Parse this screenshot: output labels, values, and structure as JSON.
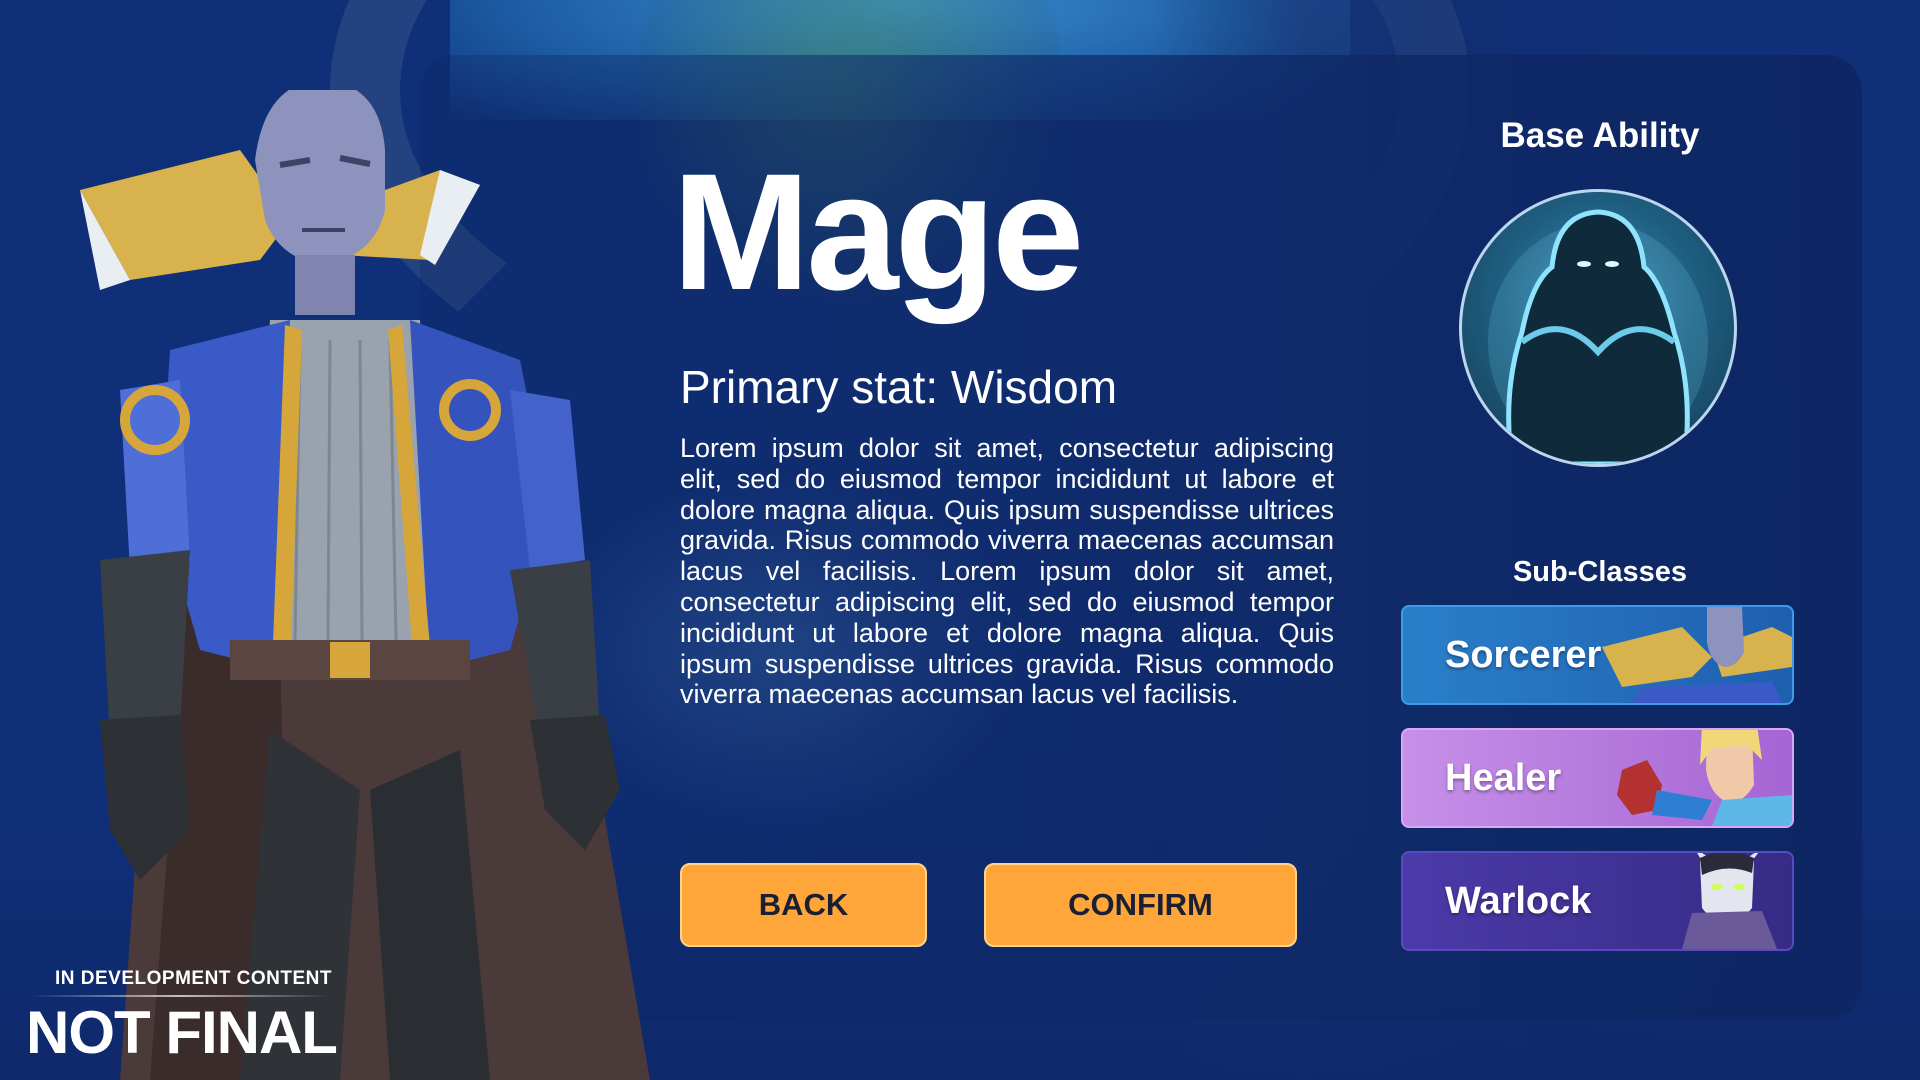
{
  "class_select": {
    "class_name": "Mage",
    "primary_stat": "Primary stat: Wisdom",
    "description": "Lorem ipsum dolor sit amet, consectetur adipiscing elit, sed do eiusmod tempor incididunt ut labore et dolore magna aliqua. Quis ipsum suspendisse ultrices gravida. Risus commodo viverra maecenas accumsan lacus vel facilisis. Lorem ipsum dolor sit amet, consectetur adipiscing elit, sed do eiusmod tempor incididunt ut labore et dolore magna aliqua. Quis ipsum suspendisse ultrices gravida. Risus commodo viverra maecenas accumsan lacus vel facilisis.",
    "back_label": "BACK",
    "confirm_label": "CONFIRM"
  },
  "base_ability": {
    "title": "Base Ability",
    "icon": "glowing-spectral-figure-icon"
  },
  "subclasses": {
    "title": "Sub-Classes",
    "items": [
      {
        "label": "Sorcerer",
        "color": "#2a7fc9"
      },
      {
        "label": "Healer",
        "color": "#c690e8"
      },
      {
        "label": "Warlock",
        "color": "#4b3aa8"
      }
    ]
  },
  "watermark": {
    "top": "IN DEVELOPMENT CONTENT",
    "main": "NOT FINAL"
  },
  "colors": {
    "button": "#ffa63a",
    "background": "#0f2f78"
  }
}
